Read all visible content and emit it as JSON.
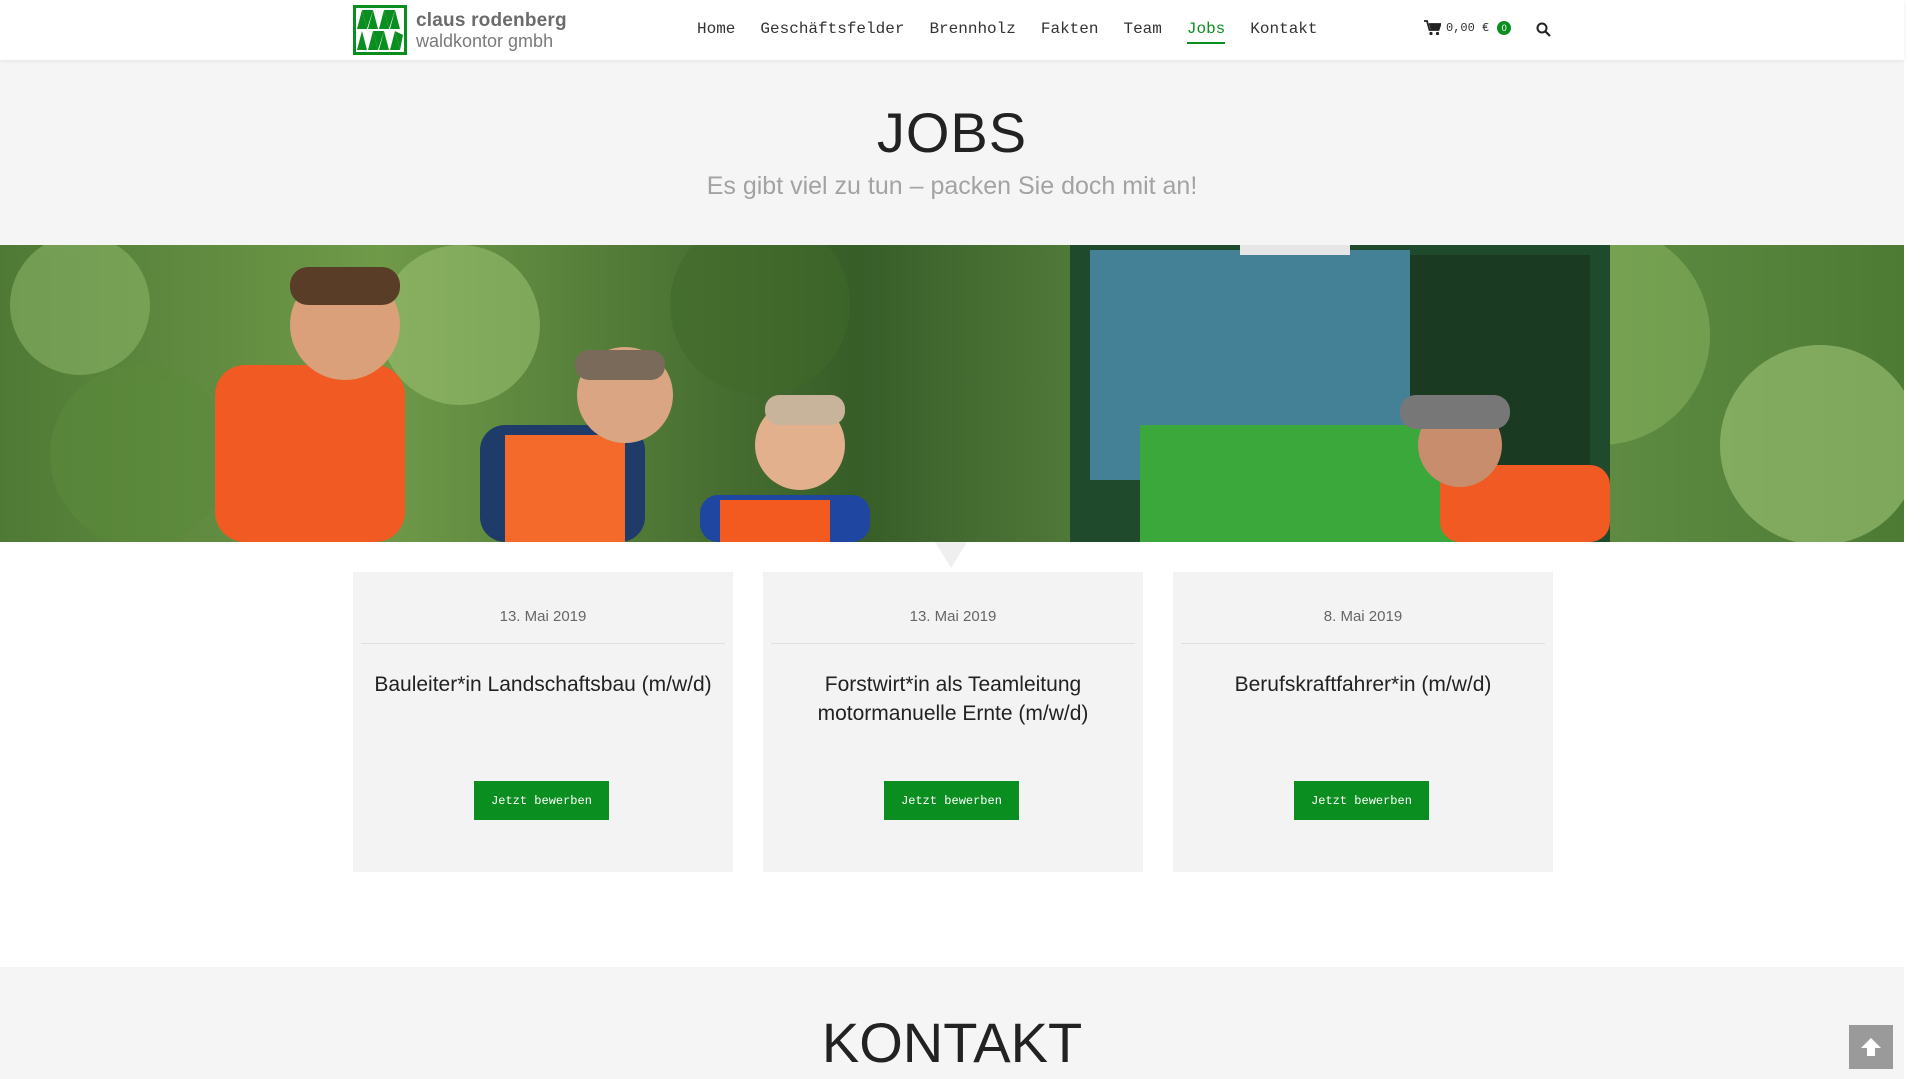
{
  "brand": {
    "line1": "claus rodenberg",
    "line2": "waldkontor gmbh",
    "color": "#0b8e20"
  },
  "nav": {
    "items": [
      {
        "label": "Home",
        "active": false
      },
      {
        "label": "Geschäftsfelder",
        "active": false
      },
      {
        "label": "Brennholz",
        "active": false
      },
      {
        "label": "Fakten",
        "active": false
      },
      {
        "label": "Team",
        "active": false
      },
      {
        "label": "Jobs",
        "active": true
      },
      {
        "label": "Kontakt",
        "active": false
      }
    ]
  },
  "cart": {
    "amount": "0,00 €",
    "count": "0",
    "icon": "cart-icon"
  },
  "search": {
    "icon": "search-icon"
  },
  "hero": {
    "title": "JOBS",
    "subtitle": "Es gibt viel zu tun – packen Sie doch mit an!"
  },
  "jobs": [
    {
      "date": "13. Mai 2019",
      "title": "Bauleiter*in Landschaftsbau (m/w/d)",
      "button": "Jetzt bewerben"
    },
    {
      "date": "13. Mai 2019",
      "title": "Forstwirt*in als Teamleitung motormanuelle Ernte (m/w/d)",
      "button": "Jetzt bewerben"
    },
    {
      "date": "8. Mai 2019",
      "title": "Berufskraftfahrer*in (m/w/d)",
      "button": "Jetzt bewerben"
    }
  ],
  "kontakt": {
    "title": "KONTAKT"
  },
  "back_to_top": {
    "icon": "arrow-up-icon"
  }
}
